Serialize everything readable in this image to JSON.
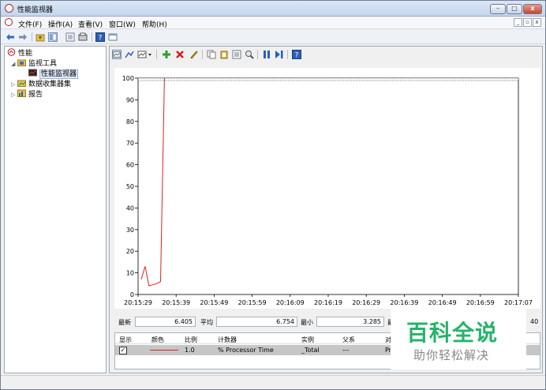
{
  "window": {
    "title": "性能监视器",
    "buttons": {
      "minimize": "–",
      "maximize": "□",
      "close": "x"
    }
  },
  "menu": {
    "items": [
      "文件(F)",
      "操作(A)",
      "查看(V)",
      "窗口(W)",
      "帮助(H)"
    ],
    "mdi_controls": [
      "_",
      "▫",
      "x"
    ]
  },
  "toolbar": {
    "icons": [
      "back-icon",
      "forward-icon",
      "up-folder-icon",
      "show-hide-tree-icon",
      "properties-icon",
      "export-icon",
      "help-icon",
      "view-icon"
    ]
  },
  "tree": {
    "root": "性能",
    "monitor_tools": "监视工具",
    "perf_monitor": "性能监视器",
    "data_collector_sets": "数据收集器集",
    "reports": "报告"
  },
  "chart_toolbar": {
    "icons": [
      "view-current-activity-icon",
      "change-graph-type-icon",
      "graph-type-dropdown-icon",
      "add-counter-icon",
      "delete-counter-icon",
      "highlight-icon",
      "copy-properties-icon",
      "paste-counter-list-icon",
      "properties-icon",
      "zoom-icon",
      "freeze-display-icon",
      "update-data-icon",
      "help-icon"
    ]
  },
  "chart_data": {
    "type": "line",
    "ylim": [
      0,
      100
    ],
    "y_ticks": [
      "100",
      "90",
      "80",
      "70",
      "60",
      "50",
      "40",
      "30",
      "20",
      "10",
      "0"
    ],
    "x_ticks": [
      "20:15:29",
      "20:15:39",
      "20:15:49",
      "20:15:59",
      "20:16:09",
      "20:16:19",
      "20:16:29",
      "20:16:39",
      "20:16:49",
      "20:16:59",
      "20:17:07"
    ],
    "series": [
      {
        "name": "% Processor Time",
        "color": "#e02020",
        "x": [
          0,
          1,
          2,
          3,
          4,
          5,
          6
        ],
        "values": [
          7,
          13,
          4,
          4.5,
          5,
          6,
          100
        ]
      }
    ]
  },
  "stats": {
    "latest_label": "最新",
    "latest_value": "6.405",
    "avg_label": "平均",
    "avg_value": "6.754",
    "min_label": "最小",
    "min_value": "3.285",
    "max_label": "最大",
    "duration_value": "40"
  },
  "counter_table": {
    "headers": [
      "显示",
      "颜色",
      "比例",
      "计数器",
      "实例",
      "父系",
      "对"
    ],
    "row": {
      "checked": "✓",
      "scale": "1.0",
      "counter": "% Processor Time",
      "instance": "_Total",
      "parent": "---",
      "object": "Pr"
    }
  },
  "watermark": {
    "title": "百科全说",
    "subtitle": "助你轻松解决"
  }
}
